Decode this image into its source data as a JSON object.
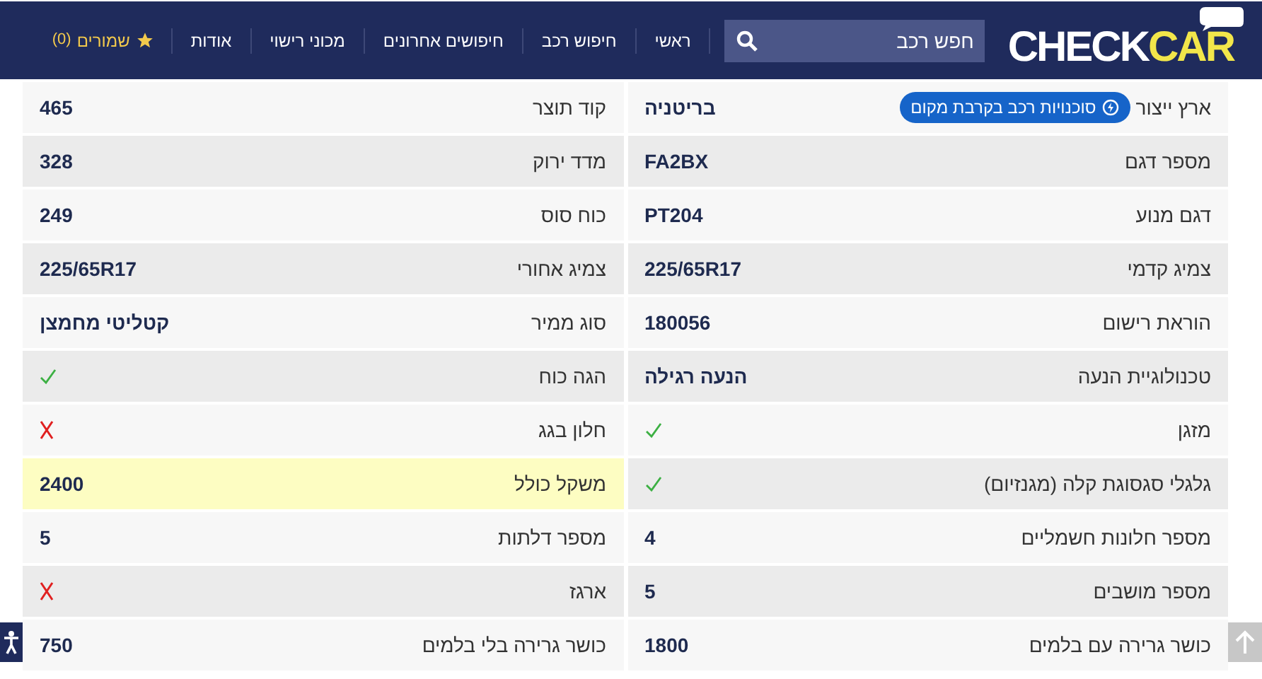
{
  "header": {
    "logo": {
      "part_1": "CHECK",
      "part_2": "CAR"
    },
    "search": {
      "placeholder": "חפש רכב"
    },
    "nav": [
      {
        "label": "ראשי"
      },
      {
        "label": "חיפוש רכב"
      },
      {
        "label": "חיפושים אחרונים"
      },
      {
        "label": "מכוני רישוי"
      },
      {
        "label": "אודות"
      }
    ],
    "saved": {
      "label": "שמורים",
      "count": "(0)"
    }
  },
  "columns": [
    {
      "rows": [
        {
          "label": "ארץ ייצור",
          "kind": "text",
          "value": "בריטניה",
          "badge": "סוכנויות רכב בקרבת מקום",
          "highlighted": false
        },
        {
          "label": "מספר דגם",
          "kind": "text",
          "value": "FA2BX",
          "highlighted": false
        },
        {
          "label": "דגם מנוע",
          "kind": "text",
          "value": "PT204",
          "highlighted": false
        },
        {
          "label": "צמיג קדמי",
          "kind": "text",
          "value": "225/65R17",
          "highlighted": false
        },
        {
          "label": "הוראת רישום",
          "kind": "text",
          "value": "180056",
          "highlighted": false
        },
        {
          "label": "טכנולוגיית הנעה",
          "kind": "text",
          "value": "הנעה רגילה",
          "highlighted": false
        },
        {
          "label": "מזגן",
          "kind": "check",
          "highlighted": false
        },
        {
          "label": "גלגלי סגסוגת קלה (מגנזיום)",
          "kind": "check",
          "highlighted": false
        },
        {
          "label": "מספר חלונות חשמליים",
          "kind": "text",
          "value": "4",
          "highlighted": false
        },
        {
          "label": "מספר מושבים",
          "kind": "text",
          "value": "5",
          "highlighted": false
        },
        {
          "label": "כושר גרירה עם בלמים",
          "kind": "text",
          "value": "1800",
          "highlighted": false
        }
      ]
    },
    {
      "rows": [
        {
          "label": "קוד תוצר",
          "kind": "text",
          "value": "465",
          "highlighted": false
        },
        {
          "label": "מדד ירוק",
          "kind": "text",
          "value": "328",
          "highlighted": false
        },
        {
          "label": "כוח סוס",
          "kind": "text",
          "value": "249",
          "highlighted": false
        },
        {
          "label": "צמיג אחורי",
          "kind": "text",
          "value": "225/65R17",
          "highlighted": false
        },
        {
          "label": "סוג ממיר",
          "kind": "text",
          "value": "קטליטי מחמצן",
          "highlighted": false
        },
        {
          "label": "הגה כוח",
          "kind": "check",
          "highlighted": false
        },
        {
          "label": "חלון בגג",
          "kind": "cross",
          "highlighted": false
        },
        {
          "label": "משקל כולל",
          "kind": "text",
          "value": "2400",
          "highlighted": true
        },
        {
          "label": "מספר דלתות",
          "kind": "text",
          "value": "5",
          "highlighted": false
        },
        {
          "label": "ארגז",
          "kind": "cross",
          "highlighted": false
        },
        {
          "label": "כושר גרירה בלי בלמים",
          "kind": "text",
          "value": "750",
          "highlighted": false
        }
      ]
    }
  ]
}
